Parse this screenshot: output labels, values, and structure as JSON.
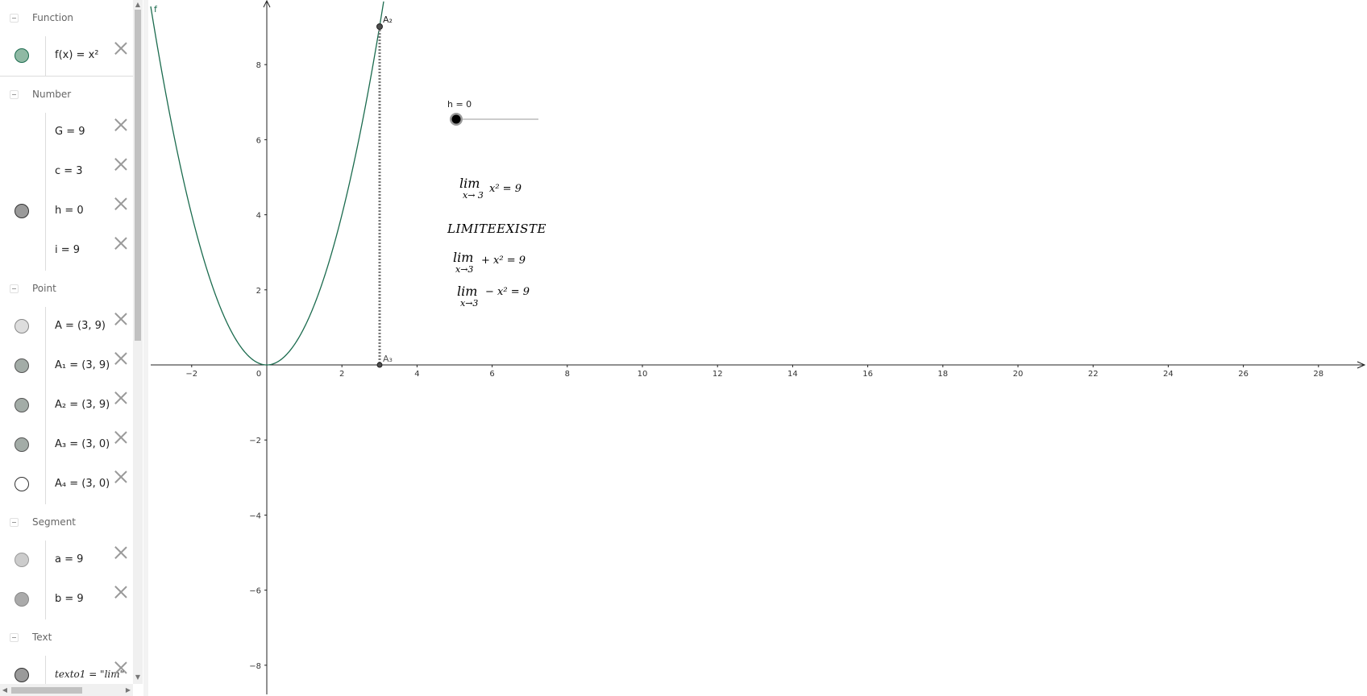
{
  "algebra": {
    "categories": {
      "function": "Function",
      "number": "Number",
      "point": "Point",
      "segment": "Segment",
      "text": "Text"
    },
    "items": {
      "f": "f(x) = x²",
      "G": "G = 9",
      "c": "c = 3",
      "h": "h = 0",
      "i": "i = 9",
      "A": "A = (3, 9)",
      "A1": "A₁ = (3, 9)",
      "A2": "A₂ = (3, 9)",
      "A3": "A₃ = (3, 0)",
      "A4": "A₄ = (3, 0)",
      "a": "a = 9",
      "b": "b = 9",
      "texto1": "texto1 = \"lim\""
    },
    "colors": {
      "function": "#8fb9a4",
      "dark": "#9a9a9a",
      "light": "#dddddd",
      "medium": "#a8a8a8",
      "green_gray": "#a3aca7",
      "empty": "#ffffff"
    }
  },
  "graphics": {
    "function_label": "f",
    "point_labels": {
      "A2": "A₂",
      "A3": "A₃"
    },
    "slider": {
      "label": "h = 0",
      "value": 0
    },
    "texts": {
      "lim_word": "lim",
      "lim1_sub": "x→ 3",
      "lim1_expr": "x² = 9",
      "exists": "LIMITEEXISTE",
      "lim2_sub": "x→3",
      "lim2_expr": "+ x² = 9",
      "lim3_sub": "x→3",
      "lim3_expr": "− x² = 9"
    },
    "axes": {
      "x_ticks": [
        "−2",
        "0",
        "2",
        "4",
        "6",
        "8",
        "10",
        "12",
        "14",
        "16",
        "18",
        "20",
        "22",
        "24",
        "26",
        "28"
      ],
      "y_ticks": [
        "8",
        "6",
        "4",
        "2",
        "−2",
        "−4",
        "−6",
        "−8"
      ]
    },
    "curve_color": "#1b6b4e",
    "segment_color": "#777777"
  }
}
